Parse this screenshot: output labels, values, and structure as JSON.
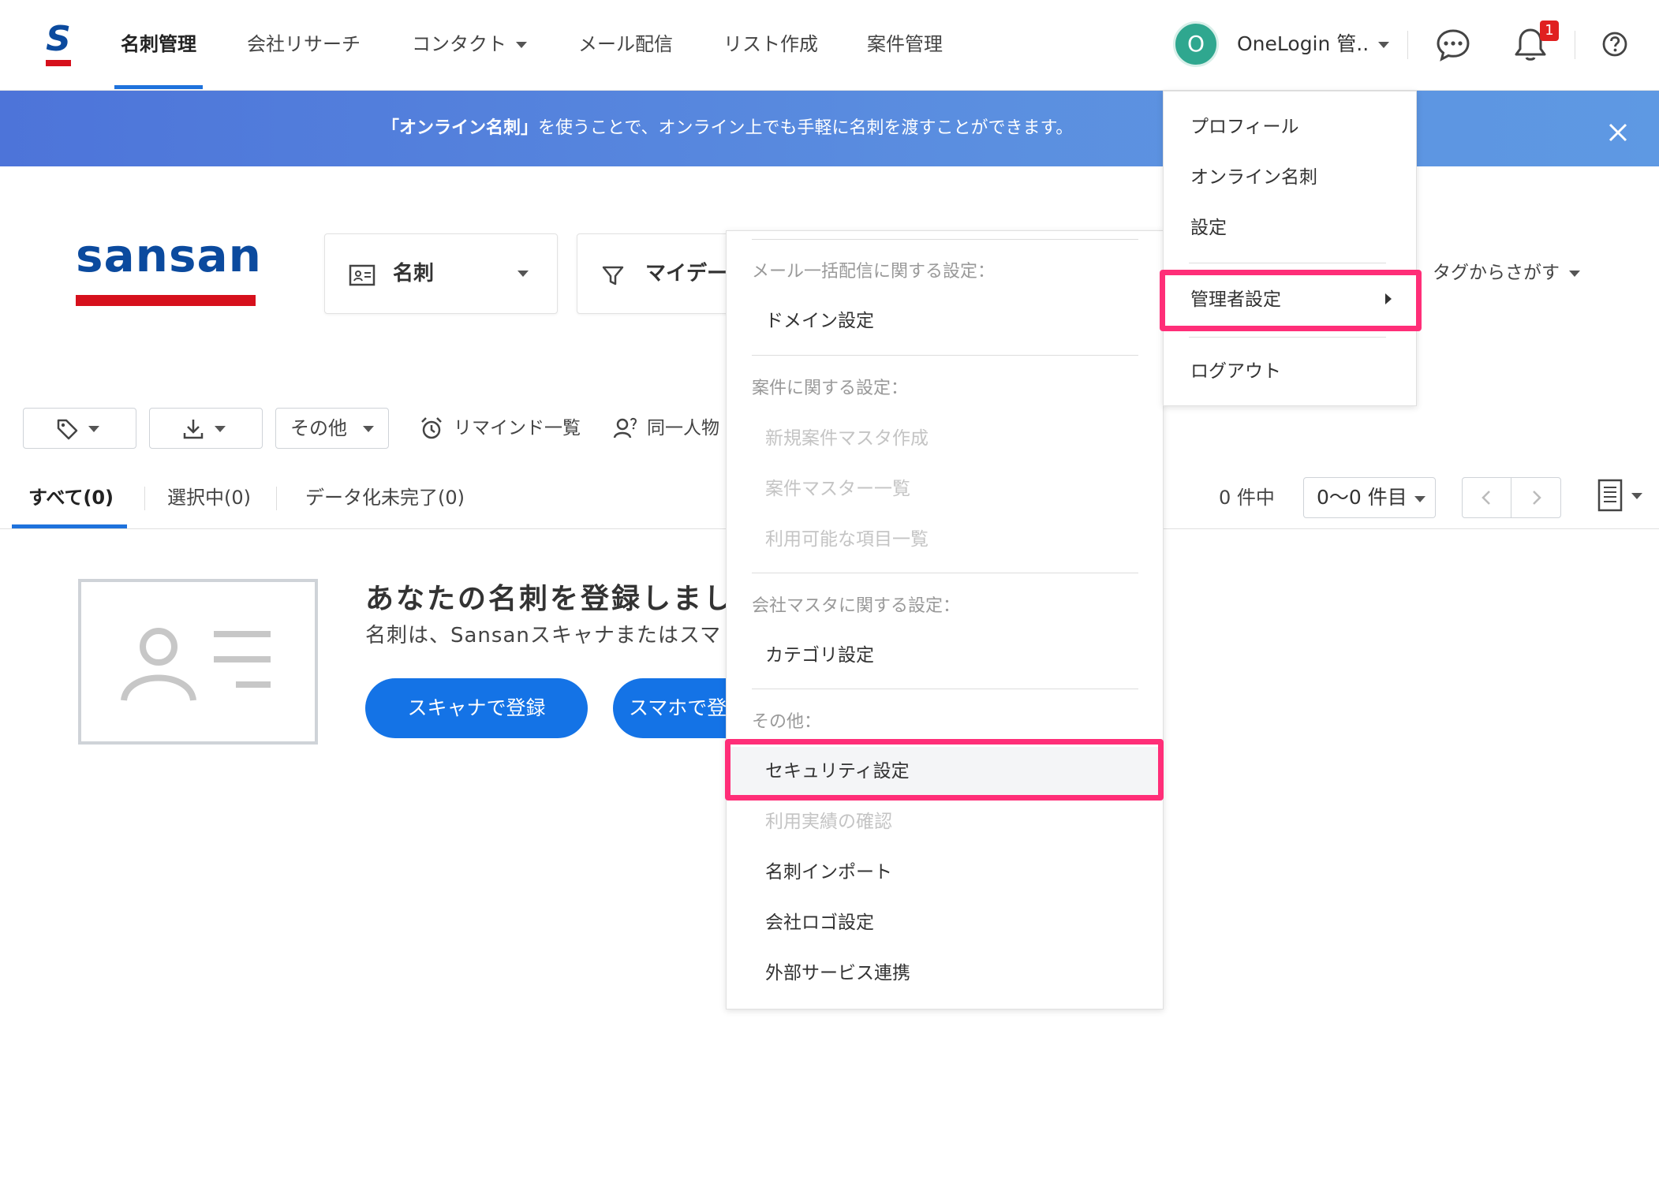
{
  "nav": {
    "brand_letter": "S",
    "items": [
      "名刺管理",
      "会社リサーチ",
      "コンタクト",
      "メール配信",
      "リスト作成",
      "案件管理"
    ],
    "active_index": 0
  },
  "user": {
    "avatar_initial": "O",
    "name": "OneLogin 管..",
    "notification_count": "1"
  },
  "banner": {
    "emphasis": "「オンライン名刺」",
    "text": "を使うことで、オンライン上でも手軽に名刺を渡すことができます。"
  },
  "logo_text": "sansan",
  "search": {
    "type_label": "名刺",
    "filter_label": "マイデー",
    "tag_search": "タグからさがす"
  },
  "toolbar": {
    "other": "その他",
    "remind": "リマインド一覧",
    "same_person": "同一人物"
  },
  "tabs": [
    {
      "label": "すべて(0)"
    },
    {
      "label": "選択中(0)"
    },
    {
      "label": "データ化未完了(0)"
    }
  ],
  "pagination": {
    "count_text": "0 件中",
    "range": "0〜0 件目"
  },
  "empty": {
    "title": "あなたの名刺を登録しまし",
    "desc": "名刺は、Sansanスキャナまたはスマ",
    "scanner_button": "スキャナで登録",
    "phone_button": "スマホで登録"
  },
  "admin_menu": {
    "sec_mail": "メール一括配信に関する設定：",
    "domain": "ドメイン設定",
    "sec_case": "案件に関する設定：",
    "new_case_master": "新規案件マスタ作成",
    "case_master_list": "案件マスター一覧",
    "available_items": "利用可能な項目一覧",
    "sec_company": "会社マスタに関する設定：",
    "category": "カテゴリ設定",
    "sec_other": "その他：",
    "security": "セキュリティ設定",
    "usage": "利用実績の確認",
    "import": "名刺インポート",
    "company_logo": "会社ロゴ設定",
    "external": "外部サービス連携"
  },
  "user_menu": {
    "profile": "プロフィール",
    "online_card": "オンライン名刺",
    "settings": "設定",
    "admin": "管理者設定",
    "logout": "ログアウト"
  },
  "colors": {
    "brand_blue": "#0b4a9e",
    "brand_red": "#d6101c",
    "accent": "#1e72dc",
    "highlight": "#ff2e78"
  }
}
